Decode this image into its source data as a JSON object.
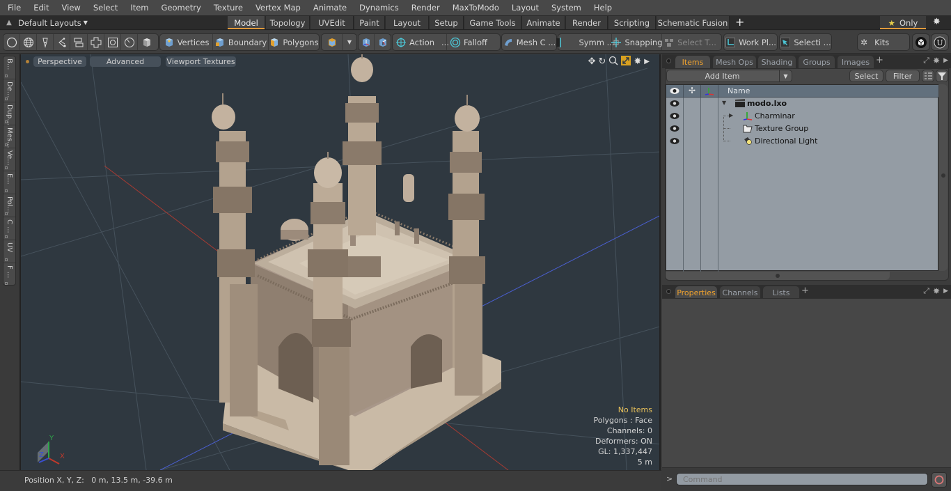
{
  "menubar": {
    "items": [
      "File",
      "Edit",
      "View",
      "Select",
      "Item",
      "Geometry",
      "Texture",
      "Vertex Map",
      "Animate",
      "Dynamics",
      "Render",
      "MaxToModo",
      "Layout",
      "System",
      "Help"
    ]
  },
  "layoutbar": {
    "selector": "Default Layouts",
    "tabs": [
      "Model",
      "Topology",
      "UVEdit",
      "Paint",
      "Layout",
      "Setup",
      "Game Tools",
      "Animate",
      "Render",
      "Scripting",
      "Schematic Fusion"
    ],
    "active_tab": "Model",
    "add_label": "+",
    "only_label": "Only"
  },
  "toolbar": {
    "vertices": "Vertices",
    "boundary": "Boundary",
    "polygons": "Polygons",
    "action": "Action",
    "action_more": "...",
    "falloff": "Falloff",
    "mesh_c": "Mesh C ...",
    "symm": "Symm ...",
    "snapping": "Snapping",
    "select_t": "Select T...",
    "work_pl": "Work Pl...",
    "selecti": "Selecti ...",
    "kits": "Kits"
  },
  "left_tabs": [
    "B...",
    "De...",
    "Dup...",
    "Mes...",
    "Ve...",
    "E...",
    "Pol...",
    "C ...",
    "UV",
    "F ..."
  ],
  "viewport": {
    "view_mode": "Perspective",
    "shading": "Advanced",
    "textures": "Viewport Textures",
    "info": {
      "selection": "No Items",
      "polygons": "Polygons : Face",
      "channels": "Channels: 0",
      "deformers": "Deformers: ON",
      "gl": "GL: 1,337,447",
      "scale": "5 m"
    },
    "axis": {
      "x": "X",
      "y": "Y",
      "z": "Z"
    },
    "colors": {
      "x_axis": "#c0392b",
      "z_axis": "#4a5fd0",
      "grid": "#46525c",
      "model": "#bfae9a"
    }
  },
  "statusbar": {
    "position": "Position X, Y, Z:   0 m, 13.5 m, -39.6 m"
  },
  "items_panel": {
    "tabs": [
      "Items",
      "Mesh Ops",
      "Shading",
      "Groups",
      "Images"
    ],
    "active_tab": "Items",
    "add_item": "Add Item",
    "select": "Select",
    "filter": "Filter",
    "column_name": "Name",
    "tree": [
      {
        "label": "modo.lxo",
        "kind": "scene",
        "bold": true,
        "expanded": true
      },
      {
        "label": "Charminar",
        "kind": "mesh",
        "bold": false,
        "expanded": false
      },
      {
        "label": "Texture Group",
        "kind": "texture-group",
        "bold": false
      },
      {
        "label": "Directional Light",
        "kind": "light",
        "bold": false
      }
    ]
  },
  "properties_panel": {
    "tabs": [
      "Properties",
      "Channels",
      "Lists"
    ],
    "active_tab": "Properties"
  },
  "command": {
    "prompt": ">",
    "placeholder": "Command"
  },
  "accent": "#e09a3c"
}
